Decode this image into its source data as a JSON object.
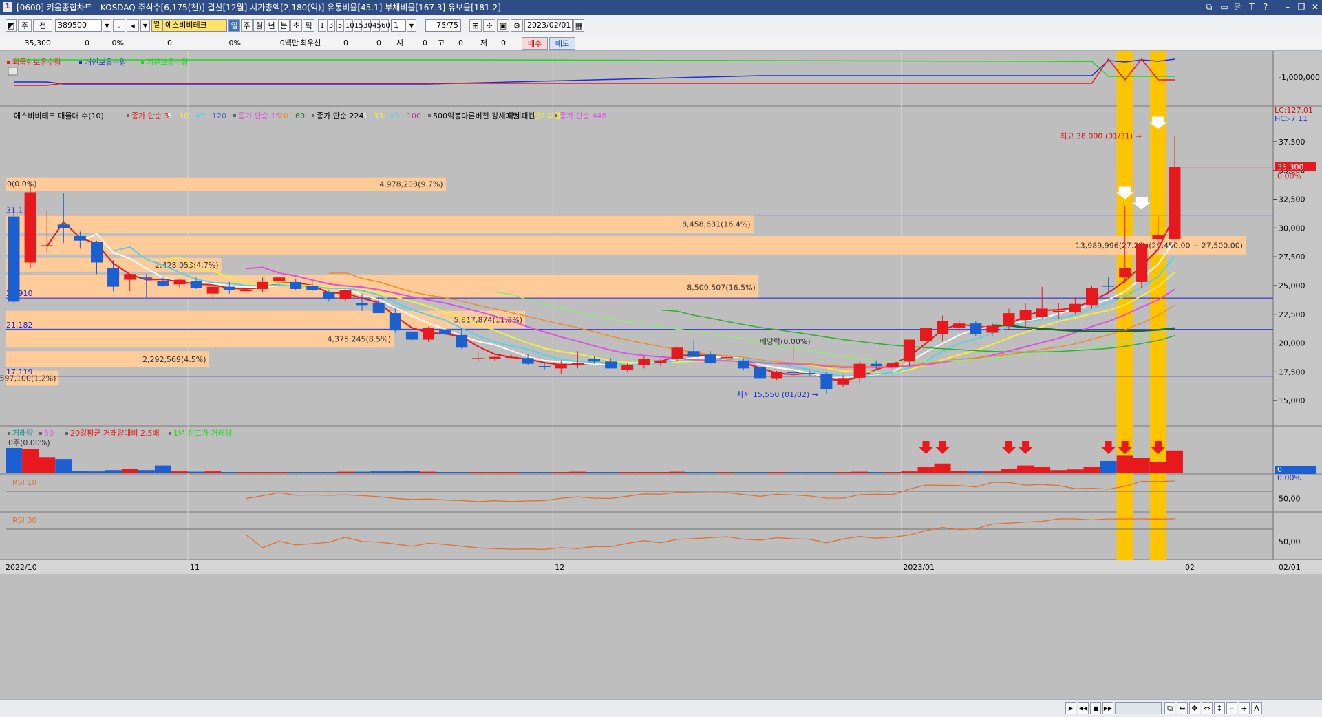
{
  "window": {
    "title": "[0600] 키움종합차트 - KOSDAQ 주식수[6,175(천)] 결산[12월] 시가총액[2,180(억)] 유통비율[45.1] 부채비율[167.3] 유보율[181.2]",
    "icon_label": "1",
    "controls": [
      "restore-tiles-icon",
      "window-icon",
      "copy-icon",
      "T",
      "?",
      "minimize-icon",
      "restore-icon",
      "close-icon"
    ]
  },
  "toolbar": {
    "period_main": "주",
    "period_sub": "전",
    "code": "389500",
    "stock_name": "에스비비테크",
    "period_buttons": [
      "일",
      "주",
      "월",
      "년",
      "분",
      "초",
      "틱"
    ],
    "interval_buttons": [
      "1",
      "3",
      "5",
      "10",
      "15",
      "30",
      "45",
      "60"
    ],
    "interval_select": "1",
    "count_display": "75/75",
    "date": "2023/02/01",
    "buy_label": "매수",
    "sell_label": "매도"
  },
  "quote_bar": {
    "price": "35,300",
    "change": "0",
    "change_pct": "0%",
    "volume": "0",
    "volume_pct": "0%",
    "amount": "0백만",
    "best_bid_label": "최우선",
    "best_bid": "0",
    "best_ask": "0",
    "open_label": "시",
    "open": "0",
    "high_label": "고",
    "high": "0",
    "low_label": "저",
    "low": "0"
  },
  "colors": {
    "up": "#e8191d",
    "down": "#1b5fd1",
    "profile_band": "#ffcc99",
    "highlight": "#ffc400",
    "background": "#bebebe"
  },
  "chart_data": [
    {
      "type": "line",
      "panel": "holdings",
      "legend": [
        "외국인보유수량",
        "개인보유수량",
        "기관보유수량"
      ],
      "legend_colors": [
        "#e8191d",
        "#1a2fd8",
        "#1ed81e"
      ],
      "y_tick_label": "-1,000,000"
    },
    {
      "type": "candlestick",
      "panel": "price",
      "title_legend": "에스비비테크 매물대 수(10)",
      "ma_legend": [
        {
          "label": "종가 단순 3",
          "color": "#e8191d"
        },
        {
          "label": "5",
          "color": "#ffffff"
        },
        {
          "label": "10",
          "color": "#f5ee3a"
        },
        {
          "label": "45",
          "color": "#4fd4e8"
        },
        {
          "label": "120",
          "color": "#3a5fd8"
        },
        {
          "label": "종가 단순 15",
          "color": "#e050e0"
        },
        {
          "label": "20",
          "color": "#f08a2a"
        },
        {
          "label": "60",
          "color": "#1a7a1a"
        },
        {
          "label": "종가 단순 224",
          "color": "#000000"
        },
        {
          "label": "5",
          "color": "#ffffff"
        },
        {
          "label": "33",
          "color": "#f5ee3a"
        },
        {
          "label": "45",
          "color": "#4fd4e8"
        },
        {
          "label": "100",
          "color": "#c03090"
        },
        {
          "label": "500억봉다른버전 강세패턴",
          "color": "#000000"
        },
        {
          "label": "약세패턴",
          "color": "#000000"
        },
        {
          "label": "단기과열",
          "color": "#f5ee3a"
        },
        {
          "label": "종가 단순 448",
          "color": "#e050e0"
        },
        {
          "label": "112",
          "color": "#c8b0e8"
        }
      ],
      "y_ticks": [
        15000,
        17500,
        20000,
        22500,
        25000,
        27500,
        30000,
        32500,
        35000,
        37500
      ],
      "y_tick_labels": [
        "15,000",
        "17,500",
        "20,000",
        "22,500",
        "25,000",
        "27,500",
        "30,000",
        "32,500",
        "35,000",
        "37,500"
      ],
      "ylim": [
        12800,
        40600
      ],
      "lc_label": "LC:127.01",
      "hc_label": "HC:-7.11",
      "current_price_label": "35,300",
      "current_pct_label": "0.00%",
      "h_lines": [
        {
          "value": 31116,
          "label": "31,116"
        },
        {
          "value": 23910,
          "label": "23,910"
        },
        {
          "value": 21182,
          "label": "21,182"
        },
        {
          "value": 17119,
          "label": "17,119"
        }
      ],
      "top_left_label": "0(0.0%)",
      "volume_profile": [
        {
          "from": 34400,
          "to": 33200,
          "width": 0.355,
          "label": "4,978,203(9.7%)"
        },
        {
          "from": 31100,
          "to": 29600,
          "width": 0.603,
          "label": "8,458,631(16.4%)"
        },
        {
          "from": 29300,
          "to": 27700,
          "width": 1.0,
          "label": "13,989,996(27.2%)(29,450.00 ~ 27,500.00)"
        },
        {
          "from": 27400,
          "to": 26200,
          "width": 0.174,
          "label": "2,428,053(4,7%)"
        },
        {
          "from": 25900,
          "to": 23800,
          "width": 0.607,
          "label": "8,500,507(16.5%)"
        },
        {
          "from": 22800,
          "to": 21300,
          "width": 0.419,
          "label": "5,817,874(11.3%)"
        },
        {
          "from": 21100,
          "to": 19600,
          "width": 0.313,
          "label": "4,375,245(8.5%)"
        },
        {
          "from": 19300,
          "to": 17900,
          "width": 0.164,
          "label": "2,292,569(4.5%)"
        },
        {
          "from": 17600,
          "to": 16300,
          "width": 0.043,
          "label": "597,100(1.2%)"
        }
      ],
      "candles": [
        {
          "o": 31000,
          "h": 31200,
          "l": 23500,
          "c": 23600
        },
        {
          "o": 27000,
          "h": 33800,
          "l": 26500,
          "c": 33100
        },
        {
          "o": 28500,
          "h": 31500,
          "l": 27900,
          "c": 28500
        },
        {
          "o": 30300,
          "h": 33000,
          "l": 28700,
          "c": 30000
        },
        {
          "o": 29300,
          "h": 29700,
          "l": 28200,
          "c": 28900
        },
        {
          "o": 28800,
          "h": 28900,
          "l": 26000,
          "c": 27000
        },
        {
          "o": 26500,
          "h": 27200,
          "l": 24500,
          "c": 24900
        },
        {
          "o": 25500,
          "h": 26000,
          "l": 24500,
          "c": 26000
        },
        {
          "o": 25700,
          "h": 26000,
          "l": 23900,
          "c": 25600
        },
        {
          "o": 25400,
          "h": 25700,
          "l": 24900,
          "c": 25000
        },
        {
          "o": 25100,
          "h": 25600,
          "l": 24800,
          "c": 25500
        },
        {
          "o": 25400,
          "h": 25700,
          "l": 24700,
          "c": 24800
        },
        {
          "o": 24300,
          "h": 24900,
          "l": 23900,
          "c": 24900
        },
        {
          "o": 24900,
          "h": 25300,
          "l": 24300,
          "c": 24600
        },
        {
          "o": 24600,
          "h": 25000,
          "l": 24300,
          "c": 24600
        },
        {
          "o": 24700,
          "h": 25700,
          "l": 24400,
          "c": 25300
        },
        {
          "o": 25400,
          "h": 25800,
          "l": 25000,
          "c": 25700
        },
        {
          "o": 25300,
          "h": 25600,
          "l": 24600,
          "c": 24700
        },
        {
          "o": 25000,
          "h": 25400,
          "l": 24500,
          "c": 24600
        },
        {
          "o": 24400,
          "h": 24600,
          "l": 23600,
          "c": 23800
        },
        {
          "o": 23800,
          "h": 24700,
          "l": 23600,
          "c": 24600
        },
        {
          "o": 23500,
          "h": 24300,
          "l": 22800,
          "c": 23300
        },
        {
          "o": 23500,
          "h": 24000,
          "l": 22800,
          "c": 22600
        },
        {
          "o": 22600,
          "h": 23000,
          "l": 20900,
          "c": 21100
        },
        {
          "o": 21000,
          "h": 21700,
          "l": 20200,
          "c": 20300
        },
        {
          "o": 20300,
          "h": 21400,
          "l": 20100,
          "c": 21300
        },
        {
          "o": 21200,
          "h": 21400,
          "l": 20600,
          "c": 20800
        },
        {
          "o": 20700,
          "h": 21300,
          "l": 19500,
          "c": 19600
        },
        {
          "o": 18700,
          "h": 19200,
          "l": 18400,
          "c": 18700
        },
        {
          "o": 18600,
          "h": 18900,
          "l": 18400,
          "c": 18800
        },
        {
          "o": 18800,
          "h": 19000,
          "l": 18600,
          "c": 18800
        },
        {
          "o": 18700,
          "h": 19000,
          "l": 18100,
          "c": 18200
        },
        {
          "o": 18000,
          "h": 18300,
          "l": 17700,
          "c": 17900
        },
        {
          "o": 17800,
          "h": 18500,
          "l": 17300,
          "c": 18200
        },
        {
          "o": 18100,
          "h": 19300,
          "l": 17800,
          "c": 18300
        },
        {
          "o": 18600,
          "h": 18900,
          "l": 18200,
          "c": 18400
        },
        {
          "o": 18400,
          "h": 18700,
          "l": 17800,
          "c": 17800
        },
        {
          "o": 17700,
          "h": 18300,
          "l": 17500,
          "c": 18100
        },
        {
          "o": 18100,
          "h": 18900,
          "l": 17800,
          "c": 18600
        },
        {
          "o": 18300,
          "h": 18600,
          "l": 18000,
          "c": 18500
        },
        {
          "o": 18600,
          "h": 19700,
          "l": 18400,
          "c": 19600
        },
        {
          "o": 19300,
          "h": 20300,
          "l": 18800,
          "c": 18800
        },
        {
          "o": 19000,
          "h": 19300,
          "l": 18200,
          "c": 18300
        },
        {
          "o": 18800,
          "h": 19000,
          "l": 18400,
          "c": 18800
        },
        {
          "o": 18500,
          "h": 18700,
          "l": 17700,
          "c": 17800
        },
        {
          "o": 17900,
          "h": 18100,
          "l": 16800,
          "c": 16900
        },
        {
          "o": 16900,
          "h": 17600,
          "l": 16800,
          "c": 17500
        },
        {
          "o": 17500,
          "h": 17700,
          "l": 17200,
          "c": 17400
        },
        {
          "o": 17400,
          "h": 17600,
          "l": 17100,
          "c": 17300
        },
        {
          "o": 17300,
          "h": 17500,
          "l": 15550,
          "c": 16000
        },
        {
          "o": 16400,
          "h": 17200,
          "l": 16200,
          "c": 16900
        },
        {
          "o": 17000,
          "h": 18500,
          "l": 16500,
          "c": 18200
        },
        {
          "o": 18200,
          "h": 18500,
          "l": 17700,
          "c": 18000
        },
        {
          "o": 17900,
          "h": 18400,
          "l": 17600,
          "c": 18300
        },
        {
          "o": 18400,
          "h": 19600,
          "l": 18000,
          "c": 20300
        },
        {
          "o": 20200,
          "h": 21800,
          "l": 19500,
          "c": 21300
        },
        {
          "o": 20800,
          "h": 22400,
          "l": 20200,
          "c": 21900
        },
        {
          "o": 21300,
          "h": 22000,
          "l": 21000,
          "c": 21700
        },
        {
          "o": 21700,
          "h": 21900,
          "l": 20600,
          "c": 20800
        },
        {
          "o": 20900,
          "h": 21800,
          "l": 20600,
          "c": 21500
        },
        {
          "o": 21500,
          "h": 23000,
          "l": 21200,
          "c": 22600
        },
        {
          "o": 22000,
          "h": 23500,
          "l": 21400,
          "c": 22900
        },
        {
          "o": 22300,
          "h": 24900,
          "l": 22100,
          "c": 23000
        },
        {
          "o": 22700,
          "h": 23500,
          "l": 22100,
          "c": 22800
        },
        {
          "o": 22700,
          "h": 24000,
          "l": 22500,
          "c": 23400
        },
        {
          "o": 23300,
          "h": 25000,
          "l": 23000,
          "c": 24800
        },
        {
          "o": 25000,
          "h": 25700,
          "l": 24400,
          "c": 24900
        },
        {
          "o": 25700,
          "h": 31900,
          "l": 25200,
          "c": 26500
        },
        {
          "o": 25300,
          "h": 28800,
          "l": 24800,
          "c": 28600
        },
        {
          "o": 29000,
          "h": 31000,
          "l": 28500,
          "c": 29400
        },
        {
          "o": 29000,
          "h": 38000,
          "l": 28500,
          "c": 35300
        }
      ],
      "annotations": [
        {
          "label": "최고 38,000 (01/31)",
          "value": 38000
        },
        {
          "label": "최저 15,550 (01/02)",
          "value": 15550
        },
        {
          "label": "배당락(0.00%)",
          "value": 18200
        }
      ],
      "highlight_candles": [
        67,
        69
      ]
    },
    {
      "type": "bar",
      "panel": "volume",
      "legend": [
        {
          "label": "거래량",
          "color": "#1e9090"
        },
        {
          "label": "50",
          "color": "#e050e0"
        },
        {
          "label": "20일평균 거래량대비 2.5배",
          "color": "#e8191d"
        },
        {
          "label": "1년 신고가 거래량",
          "color": "#1ed81e"
        }
      ],
      "top_label": "0주(0.00%)",
      "right_value_label": "0",
      "right_pct_label": "0.00%",
      "values": [
        3.8,
        3.6,
        2.4,
        2.1,
        0.3,
        0.2,
        0.4,
        0.6,
        0.4,
        1.1,
        0.2,
        0.15,
        0.2,
        0.1,
        0.1,
        0.1,
        0.1,
        0.1,
        0.1,
        0.1,
        0.15,
        0.15,
        0.2,
        0.2,
        0.25,
        0.15,
        0.1,
        0.1,
        0.1,
        0.1,
        0.1,
        0.1,
        0.1,
        0.1,
        0.15,
        0.1,
        0.1,
        0.1,
        0.1,
        0.1,
        0.15,
        0.1,
        0.1,
        0.1,
        0.1,
        0.1,
        0.1,
        0.1,
        0.1,
        0.1,
        0.1,
        0.15,
        0.1,
        0.1,
        0.2,
        0.9,
        1.4,
        0.3,
        0.2,
        0.2,
        0.6,
        1.1,
        0.9,
        0.4,
        0.5,
        0.9,
        1.8,
        2.7,
        2.3,
        1.6,
        3.4
      ],
      "marked": [
        55,
        56,
        60,
        61,
        66,
        67,
        69
      ]
    },
    {
      "type": "line",
      "panel": "rsi18",
      "legend": "RSI 18",
      "y_tick_label": "50,00",
      "ylim": [
        0,
        100
      ]
    },
    {
      "type": "line",
      "panel": "rsi30",
      "legend": "RSI 30",
      "y_tick_label": "50,00",
      "ylim": [
        0,
        100
      ]
    }
  ],
  "x_axis": {
    "labels": [
      {
        "text": "2022/10",
        "index": 0
      },
      {
        "text": "11",
        "index": 11
      },
      {
        "text": "12",
        "index": 33
      },
      {
        "text": "2023/01",
        "index": 54
      },
      {
        "text": "02",
        "index": 74
      }
    ],
    "right_label": "02/01"
  }
}
